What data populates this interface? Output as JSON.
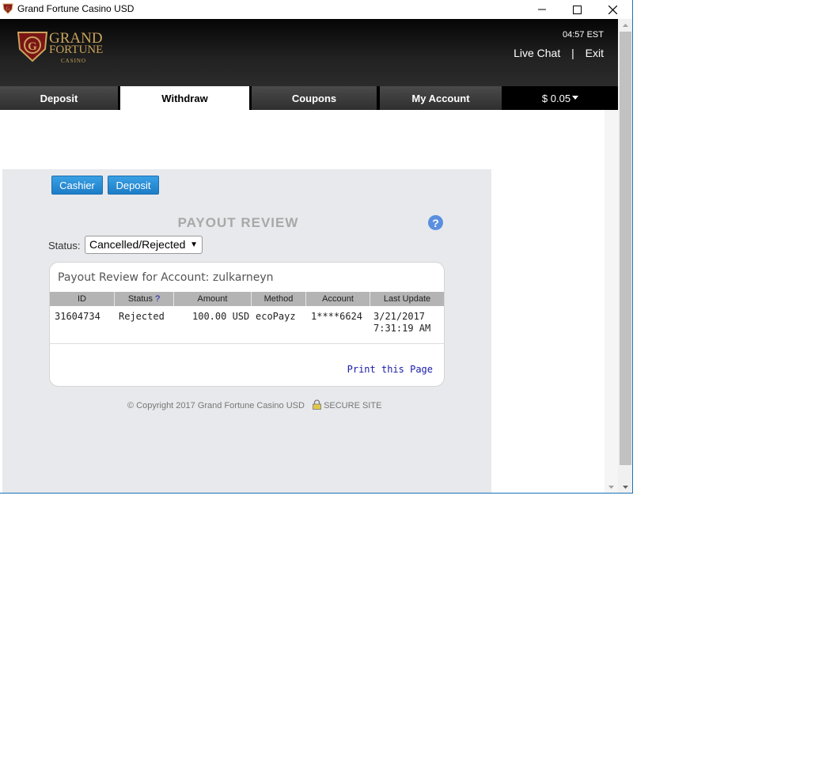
{
  "window": {
    "title": "Grand Fortune Casino USD"
  },
  "header": {
    "logo_line1": "GRAND",
    "logo_line2": "FORTUNE",
    "logo_line3": "CASINO",
    "time": "04:57 EST",
    "live_chat": "Live Chat",
    "separator": "|",
    "exit": "Exit"
  },
  "tabs": [
    {
      "label": "Deposit",
      "active": false
    },
    {
      "label": "Withdraw",
      "active": true
    },
    {
      "label": "Coupons",
      "active": false
    },
    {
      "label": "My Account",
      "active": false
    }
  ],
  "balance": "$ 0.05",
  "panel": {
    "cashier_button": "Cashier",
    "deposit_button": "Deposit",
    "title": "PAYOUT REVIEW",
    "help": "?",
    "status_label": "Status:",
    "status_value": "Cancelled/Rejected",
    "card_title": "Payout Review for Account: zulkarneyn",
    "columns": [
      "ID",
      "Status",
      "Amount",
      "Method",
      "Account",
      "Last Update"
    ],
    "status_help": "?",
    "rows": [
      {
        "id": "31604734",
        "status": "Rejected",
        "amount": "100.00 USD",
        "method": "ecoPayz",
        "account": "1****6624",
        "date": "3/21/2017",
        "time": "7:31:19 AM"
      }
    ],
    "print_link": "Print this Page",
    "footer": "© Copyright 2017 Grand Fortune Casino USD",
    "secure": "SECURE SITE"
  },
  "colors": {
    "accent": "#1d7dc7",
    "header_bg": "#111111",
    "gold": "#c9a35c",
    "panel_bg": "#e8e9ec"
  }
}
